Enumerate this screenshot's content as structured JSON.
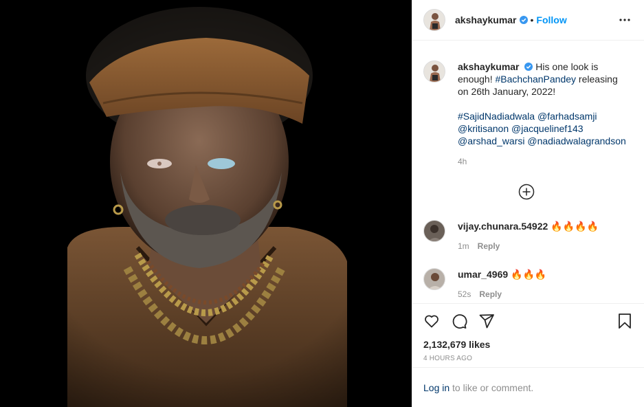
{
  "post": {
    "username": "akshaykumar",
    "verified": true,
    "follow_label": "Follow",
    "separator": "•",
    "more_icon": "more-horizontal-icon",
    "caption": {
      "text": "His one look is enough! ",
      "hashtag": "#BachchanPandey",
      "text2": " releasing on 26th January, 2022!",
      "mentions_line1": "#SajidNadiadwala @farhadsamji",
      "mentions_line2": "@kritisanon @jacquelinef143",
      "mentions_line3": "@arshad_warsi @nadiadwalagrandson",
      "age": "4h"
    },
    "load_more_icon": "plus-circle-icon",
    "comments": [
      {
        "username": "vijay.chunara.54922",
        "text": "🔥🔥🔥🔥",
        "age": "1m",
        "reply_label": "Reply"
      },
      {
        "username": "umar_4969",
        "text": "🔥🔥🔥",
        "age": "52s",
        "reply_label": "Reply"
      }
    ],
    "likes": "2,132,679 likes",
    "timestamp": "4 HOURS AGO",
    "login_link": "Log in",
    "login_suffix": " to like or comment.",
    "colors": {
      "link": "#00376b",
      "follow": "#0095f6",
      "verified": "#3897f0",
      "muted": "#8e8e8e"
    }
  }
}
